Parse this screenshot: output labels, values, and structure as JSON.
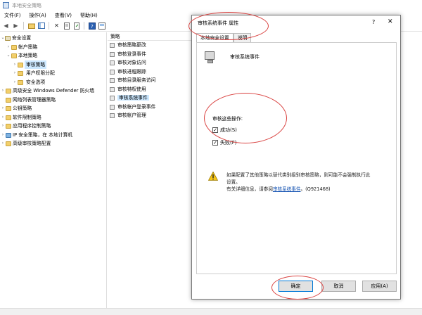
{
  "window": {
    "title": "本地安全策略"
  },
  "menu": [
    "文件(F)",
    "操作(A)",
    "查看(V)",
    "帮助(H)"
  ],
  "tree": {
    "items": [
      {
        "label": "安全设置",
        "level": 0,
        "expander": "⌄",
        "icon": "shield"
      },
      {
        "label": "帐户策略",
        "level": 1,
        "expander": "›",
        "icon": "folder"
      },
      {
        "label": "本地策略",
        "level": 1,
        "expander": "⌄",
        "icon": "folder"
      },
      {
        "label": "审核策略",
        "level": 2,
        "expander": "›",
        "icon": "folder",
        "selected": true
      },
      {
        "label": "用户权限分配",
        "level": 2,
        "expander": "›",
        "icon": "folder"
      },
      {
        "label": "安全选项",
        "level": 2,
        "expander": "›",
        "icon": "folder"
      },
      {
        "label": "高级安全 Windows Defender 防火墙",
        "level": 1,
        "expander": "›",
        "icon": "folder"
      },
      {
        "label": "网络列表管理器策略",
        "level": 1,
        "expander": "",
        "icon": "folder"
      },
      {
        "label": "公钥策略",
        "level": 1,
        "expander": "›",
        "icon": "folder"
      },
      {
        "label": "软件限制策略",
        "level": 1,
        "expander": "›",
        "icon": "folder"
      },
      {
        "label": "应用程序控制策略",
        "level": 1,
        "expander": "›",
        "icon": "folder"
      },
      {
        "label": "IP 安全策略，在 本地计算机",
        "level": 1,
        "expander": "›",
        "icon": "network"
      },
      {
        "label": "高级审核策略配置",
        "level": 1,
        "expander": "›",
        "icon": "folder"
      }
    ]
  },
  "policy_list": {
    "header": "策略",
    "items": [
      {
        "label": "审核策略更改"
      },
      {
        "label": "审核登录事件"
      },
      {
        "label": "审核对象访问"
      },
      {
        "label": "审核进程跟踪"
      },
      {
        "label": "审核目录服务访问"
      },
      {
        "label": "审核特权使用"
      },
      {
        "label": "审核系统事件",
        "selected": true
      },
      {
        "label": "审核帐户登录事件"
      },
      {
        "label": "审核帐户管理"
      }
    ]
  },
  "dialog": {
    "title": "审核系统事件 属性",
    "help": "?",
    "close": "✕",
    "tabs": [
      "本地安全设置",
      "说明"
    ],
    "policy_name": "审核系统事件",
    "audit_label": "审核这些操作:",
    "checkboxes": [
      {
        "label": "成功(S)",
        "checked": true
      },
      {
        "label": "失败(F)",
        "checked": true
      }
    ],
    "warning_line1": "如果配置了其他策略以替代类别级别审核策略，则可能不会强制执行此",
    "warning_line2": "设置。",
    "warning_line3_pre": "有关详细信息，请参阅",
    "warning_link": "审核系统事件",
    "warning_line3_post": "。(Q921468)",
    "buttons": {
      "ok": "确定",
      "cancel": "取消",
      "apply": "应用(A)"
    }
  },
  "colors": {
    "selection": "#cce8ff",
    "link": "#1a57b4",
    "annotation": "#d9413f",
    "primary_border": "#0078d7"
  }
}
